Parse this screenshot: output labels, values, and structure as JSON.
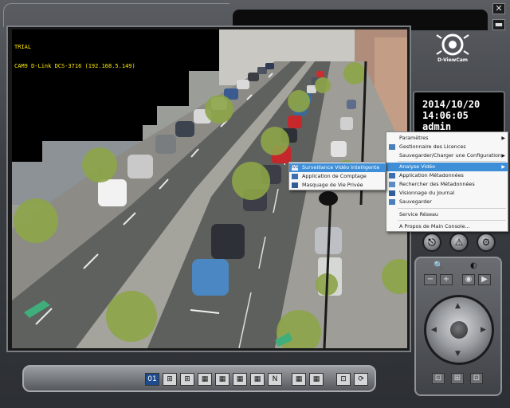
{
  "window": {
    "minimize_glyph": "▁",
    "close_glyph": "✕",
    "collapse_glyph": "▬"
  },
  "camera": {
    "label_line1": "TRIAL",
    "label_line2": "CAM9 D-Link DCS-3716 (192.168.5.149)",
    "label_color": "#ffe800"
  },
  "logo": {
    "text": "D-ViewCam"
  },
  "clock": {
    "date": "2014/10/20",
    "time": "14:06:05",
    "user": "admin"
  },
  "main_menu": {
    "items": [
      {
        "label": "Paramètres",
        "has_submenu": true,
        "icon": ""
      },
      {
        "label": "Gestionnaire des Licences",
        "has_submenu": false,
        "icon": "license-icon"
      },
      {
        "label": "Sauvegarder/Charger une Configuration",
        "has_submenu": true,
        "icon": ""
      },
      {
        "label": "Analyse Vidéo",
        "has_submenu": true,
        "icon": "",
        "highlighted": true
      },
      {
        "label": "Application Métadonnées",
        "has_submenu": false,
        "icon": "metadata-icon"
      },
      {
        "label": "Rechercher des Métadonnées",
        "has_submenu": false,
        "icon": "search-metadata-icon"
      },
      {
        "label": "Visionnage du Journal",
        "has_submenu": false,
        "icon": "log-icon"
      },
      {
        "label": "Sauvegarder",
        "has_submenu": false,
        "icon": "save-icon"
      },
      {
        "label": "Service Réseau",
        "has_submenu": false,
        "icon": ""
      },
      {
        "label": "A Propos de Main Console...",
        "has_submenu": false,
        "icon": ""
      }
    ]
  },
  "sub_menu": {
    "items": [
      {
        "label": "Surveillance Vidéo Intelligente",
        "icon": "ivs-icon",
        "highlighted": true
      },
      {
        "label": "Application de Comptage",
        "icon": "counting-icon"
      },
      {
        "label": "Masquage de Vie Privée",
        "icon": "privacy-icon"
      }
    ]
  },
  "toolbar": {
    "layout_active_label": "01",
    "layout_n_label": "N"
  },
  "colors": {
    "menu_highlight": "#3e8fd8",
    "active_layout": "#1e4a8e"
  }
}
